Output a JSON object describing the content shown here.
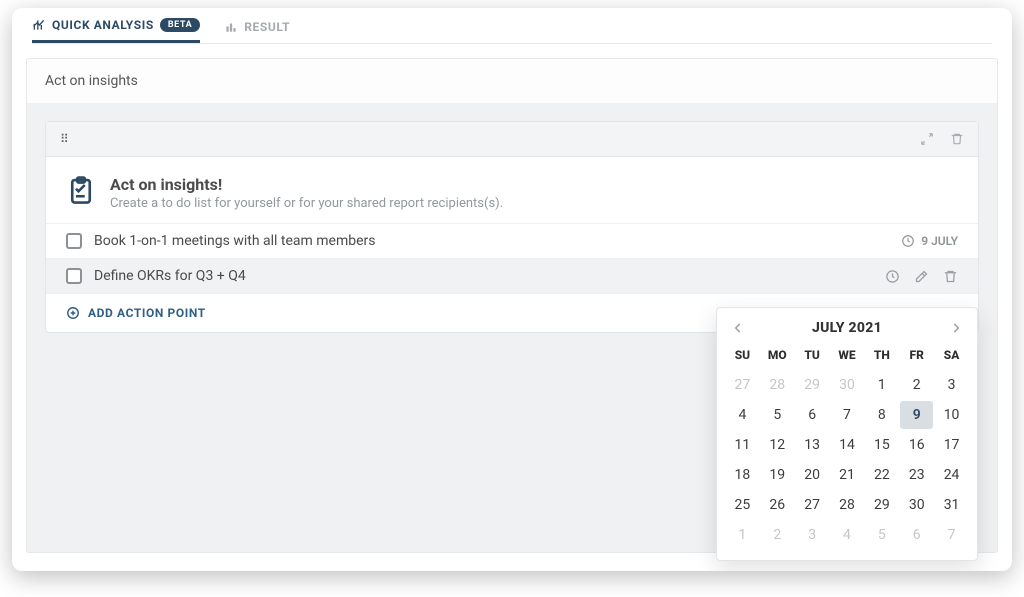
{
  "tabs": {
    "quick_analysis": {
      "label": "QUICK ANALYSIS",
      "badge": "BETA"
    },
    "result": {
      "label": "RESULT"
    }
  },
  "header": {
    "title": "Act on insights"
  },
  "panel": {
    "intro_title": "Act on insights!",
    "intro_sub": "Create a to do list for yourself or for your shared report recipients(s).",
    "actions": [
      {
        "label": "Book 1-on-1 meetings with all team members",
        "date": "9 JULY",
        "selected": false
      },
      {
        "label": "Define OKRs for Q3 + Q4",
        "date": null,
        "selected": true
      }
    ],
    "add_label": "ADD ACTION POINT"
  },
  "datepicker": {
    "title": "JULY 2021",
    "dows": [
      "SU",
      "MO",
      "TU",
      "WE",
      "TH",
      "FR",
      "SA"
    ],
    "cells": [
      {
        "d": 27,
        "other": true
      },
      {
        "d": 28,
        "other": true
      },
      {
        "d": 29,
        "other": true
      },
      {
        "d": 30,
        "other": true
      },
      {
        "d": 1
      },
      {
        "d": 2
      },
      {
        "d": 3
      },
      {
        "d": 4
      },
      {
        "d": 5
      },
      {
        "d": 6
      },
      {
        "d": 7
      },
      {
        "d": 8
      },
      {
        "d": 9,
        "selected": true
      },
      {
        "d": 10
      },
      {
        "d": 11
      },
      {
        "d": 12
      },
      {
        "d": 13
      },
      {
        "d": 14
      },
      {
        "d": 15
      },
      {
        "d": 16
      },
      {
        "d": 17
      },
      {
        "d": 18
      },
      {
        "d": 19
      },
      {
        "d": 20
      },
      {
        "d": 21
      },
      {
        "d": 22
      },
      {
        "d": 23
      },
      {
        "d": 24
      },
      {
        "d": 25
      },
      {
        "d": 26
      },
      {
        "d": 27
      },
      {
        "d": 28
      },
      {
        "d": 29
      },
      {
        "d": 30
      },
      {
        "d": 31
      },
      {
        "d": 1,
        "other": true
      },
      {
        "d": 2,
        "other": true
      },
      {
        "d": 3,
        "other": true
      },
      {
        "d": 4,
        "other": true
      },
      {
        "d": 5,
        "other": true
      },
      {
        "d": 6,
        "other": true
      },
      {
        "d": 7,
        "other": true
      }
    ]
  }
}
